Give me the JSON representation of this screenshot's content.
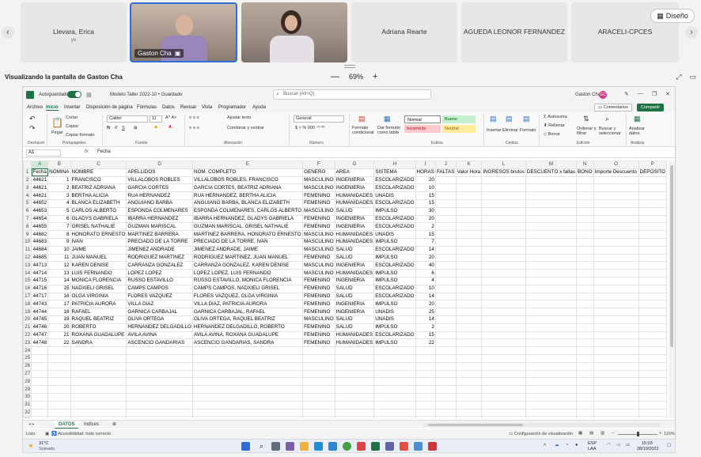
{
  "meeting": {
    "tiles": [
      {
        "name": "Llevara, Erica",
        "sub": "yo"
      },
      {
        "name": "Gaston Cha"
      },
      {
        "name": ""
      },
      {
        "name": "Adriana Rearte"
      },
      {
        "name": "AGUEDA LEONOR FERNANDEZ"
      },
      {
        "name": "ARACELI-CPCES"
      }
    ],
    "design_label": "Diseño",
    "share_label": "Visualizando la pantalla de Gaston Cha",
    "zoom": "69%",
    "zoom_minus": "—",
    "zoom_plus": "+"
  },
  "excel": {
    "autosave": "Autoguardado",
    "doc_title": "Modelo Taller 2022-10 • Guardado",
    "search_placeholder": "Buscar (Alt+Q)",
    "user": "Gaston Cha",
    "avatar_initials": "GC",
    "menu_tabs": [
      "Archivo",
      "Inicio",
      "Insertar",
      "Disposición de página",
      "Fórmulas",
      "Datos",
      "Revisar",
      "Vista",
      "Programador",
      "Ayuda"
    ],
    "comments": "Comentarios",
    "share": "Compartir",
    "ribbon": {
      "undo_label": "Deshacer",
      "paste": "Pegar",
      "cut": "Cortar",
      "copy": "Copiar",
      "format_painter": "Copiar formato",
      "clipboard": "Portapapeles",
      "font_name": "Calibri",
      "font_size": "11",
      "font_group": "Fuente",
      "wrap": "Ajustar texto",
      "merge": "Combinar y centrar",
      "align_group": "Alineación",
      "number_format": "General",
      "number_group": "Número",
      "cond_format": "Formato condicional",
      "format_table": "Dar formato como tabla",
      "style_normal": "Normal",
      "style_bueno": "Bueno",
      "style_incorrecto": "Incorrecto",
      "style_neutral": "Neutral",
      "styles_group": "Estilos",
      "insert": "Insertar",
      "delete": "Eliminar",
      "format": "Formato",
      "cells_group": "Celdas",
      "autosum": "Autosuma",
      "fill": "Rellenar",
      "clear": "Borrar",
      "sort": "Ordenar y filtrar",
      "find": "Buscar y seleccionar",
      "editing_group": "Edición",
      "analyze": "Analizar datos",
      "analysis_group": "Análisis"
    },
    "name_box": "A1",
    "formula": "Fecha",
    "columns": [
      "A",
      "B",
      "C",
      "D",
      "E",
      "F",
      "G",
      "H",
      "I",
      "J",
      "K",
      "L",
      "M",
      "N",
      "O",
      "P"
    ],
    "header_row": [
      "Fecha",
      "NOMINA",
      "NOMBRE",
      "APELLIDOS",
      "NOM. COMPLETO",
      "GENERO",
      "AREA",
      "SISTEMA",
      "HORAS",
      "FALTAS",
      "Valor Hora",
      "INGRESOS brutos",
      "DESCUENTO x faltas",
      "BONO",
      "Importe Descuento",
      "DEPOSITO"
    ],
    "rows": [
      [
        "44621",
        "1",
        "FRANCISCO",
        "VILLALOBOS ROBLES",
        "VILLALOBOS ROBLES, FRANCISCO",
        "MASCULINO",
        "INGENIERIA",
        "ESCOLARIZADO",
        "20"
      ],
      [
        "44621",
        "2",
        "BEATRIZ ADRIANA",
        "GARCIA CORTES",
        "GARCIA CORTES, BEATRIZ ADRIANA",
        "MASCULINO",
        "INGENIERIA",
        "ESCOLARIZADO",
        "10"
      ],
      [
        "44621",
        "3",
        "BERTHA ALICIA",
        "RUA HERNANDEZ",
        "RUA HERNANDEZ, BERTHA ALICIA",
        "FEMENINO",
        "HUMANIDADES",
        "UNADIS",
        "15"
      ],
      [
        "44652",
        "4",
        "BLANCA ELIZABETH",
        "ANGUIANO BARBA",
        "ANGUIANO BARBA, BLANCA ELIZABETH",
        "FEMENINO",
        "HUMANIDADES",
        "ESCOLARIZADO",
        "15"
      ],
      [
        "44653",
        "5",
        "CARLOS ALBERTO",
        "ESPONDA COLMENARES",
        "ESPONDA COLMENARES, CARLOS ALBERTO",
        "MASCULINO",
        "SALUD",
        "IMPULSO",
        "30"
      ],
      [
        "44654",
        "6",
        "GLADYS GABRIELA",
        "IBARRA HERNANDEZ",
        "IBARRA HERNANDEZ, GLADYS GABRIELA",
        "FEMENINO",
        "INGENIERIA",
        "ESCOLARIZADO",
        "20"
      ],
      [
        "44655",
        "7",
        "GRISEL NATHALIE",
        "GUZMAN MARISCAL",
        "GUZMAN MARISCAL, GRISEL NATHALIE",
        "FEMENINO",
        "INGENIERIA",
        "ESCOLARIZADO",
        "2"
      ],
      [
        "44682",
        "8",
        "HONORATO ERNESTO",
        "MARTINEZ BARRERA",
        "MARTINEZ BARRERA, HONORATO ERNESTO",
        "MASCULINO",
        "HUMANIDADES",
        "UNADIS",
        "15"
      ],
      [
        "44683",
        "9",
        "IVAN",
        "PRECIADO DE LA TORRE",
        "PRECIADO DE LA TORRE, IVAN",
        "MASCULINO",
        "HUMANIDADES",
        "IMPULSO",
        "7"
      ],
      [
        "44684",
        "10",
        "JAIME",
        "JIMENEZ ANDRADE",
        "JIMENEZ ANDRADE, JAIME",
        "MASCULINO",
        "SALUD",
        "ESCOLARIZADO",
        "14"
      ],
      [
        "44685",
        "11",
        "JUAN MANUEL",
        "RODRIGUEZ MARTINEZ",
        "RODRIGUEZ MARTINEZ, JUAN MANUEL",
        "FEMENINO",
        "SALUD",
        "IMPULSO",
        "20"
      ],
      [
        "44713",
        "12",
        "KAREN DENISE",
        "CARRANZA GONZALEZ",
        "CARRANZA GONZALEZ, KAREN DENISE",
        "MASCULINO",
        "INGENIERIA",
        "ESCOLARIZADO",
        "40"
      ],
      [
        "44714",
        "13",
        "LUIS FERNANDO",
        "LOPEZ LOPEZ",
        "LOPEZ LOPEZ, LUIS FERNANDO",
        "MASCULINO",
        "HUMANIDADES",
        "IMPULSO",
        "6"
      ],
      [
        "44715",
        "14",
        "MONICA FLORENCIA",
        "RUSSO ESTAVILLO",
        "RUSSO ESTAVILLO, MONICA FLORENCIA",
        "FEMENINO",
        "INGENIERIA",
        "IMPULSO",
        "4"
      ],
      [
        "44716",
        "15",
        "NADXIELI GRISEL",
        "CAMPS CAMPOS",
        "CAMPS CAMPOS, NADXIELI GRISEL",
        "FEMENINO",
        "SALUD",
        "ESCOLARIZADO",
        "10"
      ],
      [
        "44717",
        "16",
        "OLGA VIRGINIA",
        "FLORES VAZQUEZ",
        "FLORES VAZQUEZ, OLGA VIRGINIA",
        "FEMENINO",
        "SALUD",
        "ESCOLARIZADO",
        "14"
      ],
      [
        "44743",
        "17",
        "PATRICIA AURORA",
        "VILLA DIAZ",
        "VILLA DIAZ, PATRICIA AURORA",
        "FEMENINO",
        "INGENIERIA",
        "IMPULSO",
        "20"
      ],
      [
        "44744",
        "18",
        "RAFAEL",
        "GARNICA CARBAJAL",
        "GARNICA CARBAJAL, RAFAEL",
        "FEMENINO",
        "INGENIERIA",
        "UNADIS",
        "25"
      ],
      [
        "44745",
        "19",
        "RAQUEL BEATRIZ",
        "OLIVA ORTEGA",
        "OLIVA ORTEGA, RAQUEL BEATRIZ",
        "MASCULINO",
        "SALUD",
        "UNADIS",
        "14"
      ],
      [
        "44746",
        "20",
        "ROBERTO",
        "HERNANDEZ DELGADILLO",
        "HERNANDEZ DELGADILLO, ROBERTO",
        "FEMENINO",
        "SALUD",
        "IMPULSO",
        "2"
      ],
      [
        "44747",
        "21",
        "ROXANA GUADALUPE",
        "AVILA AVINA",
        "AVILA AVINA, ROXANA GUADALUPE",
        "FEMENINO",
        "HUMANIDADES",
        "ESCOLARIZADO",
        "15"
      ],
      [
        "44748",
        "22",
        "SANDRA",
        "ASCENCIO GANDARIAS",
        "ASCENCIO GANDARIAS, SANDRA",
        "FEMENINO",
        "HUMANIDADES",
        "IMPULSO",
        "22"
      ]
    ],
    "empty_row_count": 11,
    "sheet_tabs": [
      "DATOS",
      "Indices"
    ],
    "status": {
      "ready": "Listo",
      "accessibility": "Accesibilidad: todo correcto",
      "display_settings": "Configuración de visualización",
      "zoom": "115%"
    }
  },
  "taskbar": {
    "weather_temp": "31°C",
    "weather_desc": "Soleado",
    "lang": "ESP",
    "lang_sub": "LAA",
    "time": "15:03",
    "date": "28/10/2022"
  }
}
